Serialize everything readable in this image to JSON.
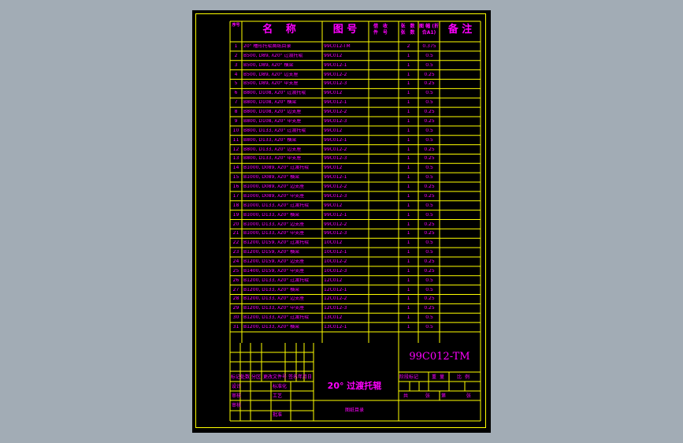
{
  "header": {
    "seq": "序号",
    "name": "名 称",
    "drawing_no": "图 号",
    "borrow": "借 收 件 号",
    "qty": "张 数 张 数",
    "size": "图 幅 (折合A1)",
    "remark": "备 注"
  },
  "rows": [
    {
      "no": "1",
      "name": "20° 槽形托辊图纸目录",
      "code": "99C012-TM",
      "qty": "2",
      "size": "0.375"
    },
    {
      "no": "2",
      "name": "B500, D89, λ20° 过渡托辊",
      "code": "99C012",
      "qty": "1",
      "size": "0.5"
    },
    {
      "no": "3",
      "name": "B500, D89, λ20° 横梁",
      "code": "99C012-1",
      "qty": "1",
      "size": "0.5"
    },
    {
      "no": "4",
      "name": "B500, D89, λ20° 边支座",
      "code": "99C012-2",
      "qty": "1",
      "size": "0.25"
    },
    {
      "no": "5",
      "name": "B500, D89, λ20° 中支座",
      "code": "99C012-3",
      "qty": "1",
      "size": "0.25"
    },
    {
      "no": "6",
      "name": "B800, D108, λ20° 过渡托辊",
      "code": "99C012",
      "qty": "1",
      "size": "0.5"
    },
    {
      "no": "7",
      "name": "B800, D108, λ20° 横梁",
      "code": "99C012-1",
      "qty": "1",
      "size": "0.5"
    },
    {
      "no": "8",
      "name": "B800, D108, λ20° 边支座",
      "code": "99C012-2",
      "qty": "1",
      "size": "0.25"
    },
    {
      "no": "9",
      "name": "B800, D108, λ20° 中支座",
      "code": "99C012-3",
      "qty": "1",
      "size": "0.25"
    },
    {
      "no": "10",
      "name": "B800, D133, λ20° 过渡托辊",
      "code": "99C012",
      "qty": "1",
      "size": "0.5"
    },
    {
      "no": "11",
      "name": "B800, D133, λ20° 横梁",
      "code": "99C012-1",
      "qty": "1",
      "size": "0.5"
    },
    {
      "no": "12",
      "name": "B800, D133, λ20° 边支座",
      "code": "99C012-2",
      "qty": "1",
      "size": "0.25"
    },
    {
      "no": "13",
      "name": "B800, D133, λ20° 中支座",
      "code": "99C012-3",
      "qty": "1",
      "size": "0.25"
    },
    {
      "no": "14",
      "name": "B1000, D089, λ20° 过渡托辊",
      "code": "99C012",
      "qty": "1",
      "size": "0.5"
    },
    {
      "no": "15",
      "name": "B1000, D089, λ20° 横梁",
      "code": "99C012-1",
      "qty": "1",
      "size": "0.5"
    },
    {
      "no": "16",
      "name": "B1000, D089, λ20° 边支座",
      "code": "99C012-2",
      "qty": "1",
      "size": "0.25"
    },
    {
      "no": "17",
      "name": "B1000, D089, λ20° 中支座",
      "code": "99C012-3",
      "qty": "1",
      "size": "0.25"
    },
    {
      "no": "18",
      "name": "B1000, D133, λ20° 过渡托辊",
      "code": "99C012",
      "qty": "1",
      "size": "0.5"
    },
    {
      "no": "19",
      "name": "B1000, D133, λ20° 横梁",
      "code": "99C012-1",
      "qty": "1",
      "size": "0.5"
    },
    {
      "no": "20",
      "name": "B1000, D133, λ20° 边支座",
      "code": "99C012-2",
      "qty": "1",
      "size": "0.25"
    },
    {
      "no": "21",
      "name": "B1000, D133, λ20° 中支座",
      "code": "99C012-3",
      "qty": "1",
      "size": "0.25"
    },
    {
      "no": "22",
      "name": "B1200, D159, λ20° 过渡托辊",
      "code": "10C012",
      "qty": "1",
      "size": "0.5"
    },
    {
      "no": "23",
      "name": "B1200, D159, λ20° 横梁",
      "code": "10C012-1",
      "qty": "1",
      "size": "0.5"
    },
    {
      "no": "24",
      "name": "B1200, D159, λ20° 边支座",
      "code": "10C012-2",
      "qty": "1",
      "size": "0.25"
    },
    {
      "no": "25",
      "name": "B1400, D159, λ20° 中支座",
      "code": "10C012-3",
      "qty": "1",
      "size": "0.25"
    },
    {
      "no": "26",
      "name": "B1200, D133, λ20° 过渡托辊",
      "code": "12C012",
      "qty": "1",
      "size": "0.5"
    },
    {
      "no": "27",
      "name": "B1200, D133, λ20° 横梁",
      "code": "12C012-1",
      "qty": "1",
      "size": "0.5"
    },
    {
      "no": "28",
      "name": "B1200, D133, λ20° 边支座",
      "code": "12C012-2",
      "qty": "1",
      "size": "0.25"
    },
    {
      "no": "29",
      "name": "B1200, D133, λ20° 中支座",
      "code": "12C012-3",
      "qty": "1",
      "size": "0.25"
    },
    {
      "no": "30",
      "name": "B1200, D133, λ20° 过渡托辊",
      "code": "13C012",
      "qty": "1",
      "size": "0.5"
    },
    {
      "no": "31",
      "name": "B1200, D133, λ20° 横梁",
      "code": "13C012-1",
      "qty": "1",
      "size": "0.5"
    }
  ],
  "title_block": {
    "drawing_no": "99C012-TM",
    "part_name": "20° 过渡托辊",
    "list_name": "图纸目录",
    "rev_headers": [
      "标记",
      "处数",
      "分区",
      "更改文件号",
      "签名",
      "年月日"
    ],
    "design": "设计",
    "std": "标准化",
    "check": "审核",
    "process": "工艺",
    "approve": "批准",
    "review": "审核",
    "stage_mark": "阶段标记",
    "weight": "重量",
    "scale": "比例",
    "sheets_total": "共 张",
    "sheet_no": "第 张"
  },
  "colors": {
    "line": "#ffff00",
    "text": "#ff00ff",
    "paper": "#000000",
    "bg": "#a2acb5"
  }
}
